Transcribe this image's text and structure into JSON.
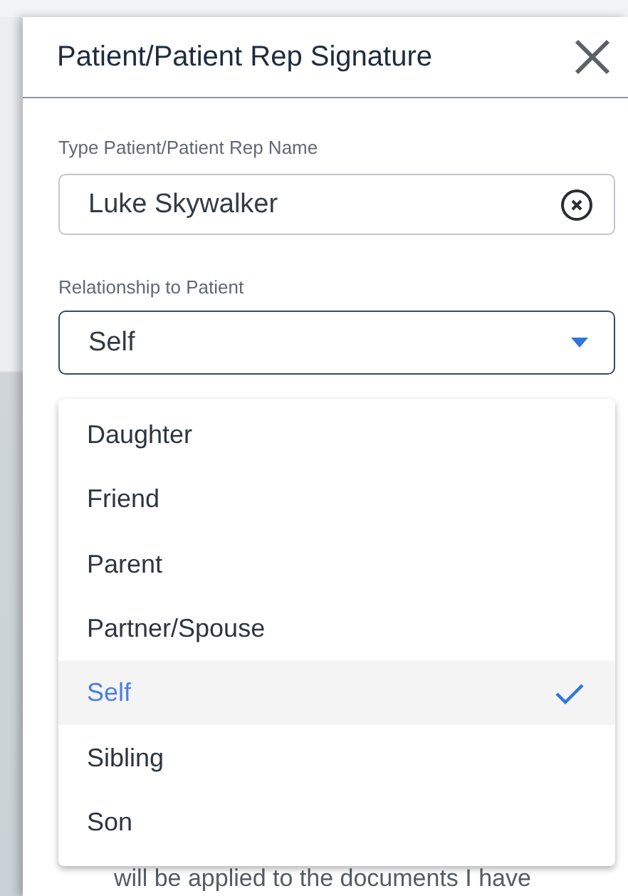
{
  "dialog": {
    "title": "Patient/Patient Rep Signature"
  },
  "name_field": {
    "label": "Type Patient/Patient Rep Name",
    "value": "Luke Skywalker"
  },
  "relationship_field": {
    "label": "Relationship to Patient",
    "value": "Self",
    "expanded": true
  },
  "options": [
    {
      "label": "Daughter",
      "selected": false
    },
    {
      "label": "Friend",
      "selected": false
    },
    {
      "label": "Parent",
      "selected": false
    },
    {
      "label": "Partner/Spouse",
      "selected": false
    },
    {
      "label": "Self",
      "selected": true
    },
    {
      "label": "Sibling",
      "selected": false
    },
    {
      "label": "Son",
      "selected": false
    }
  ],
  "background_text": "will be applied to the documents I have"
}
